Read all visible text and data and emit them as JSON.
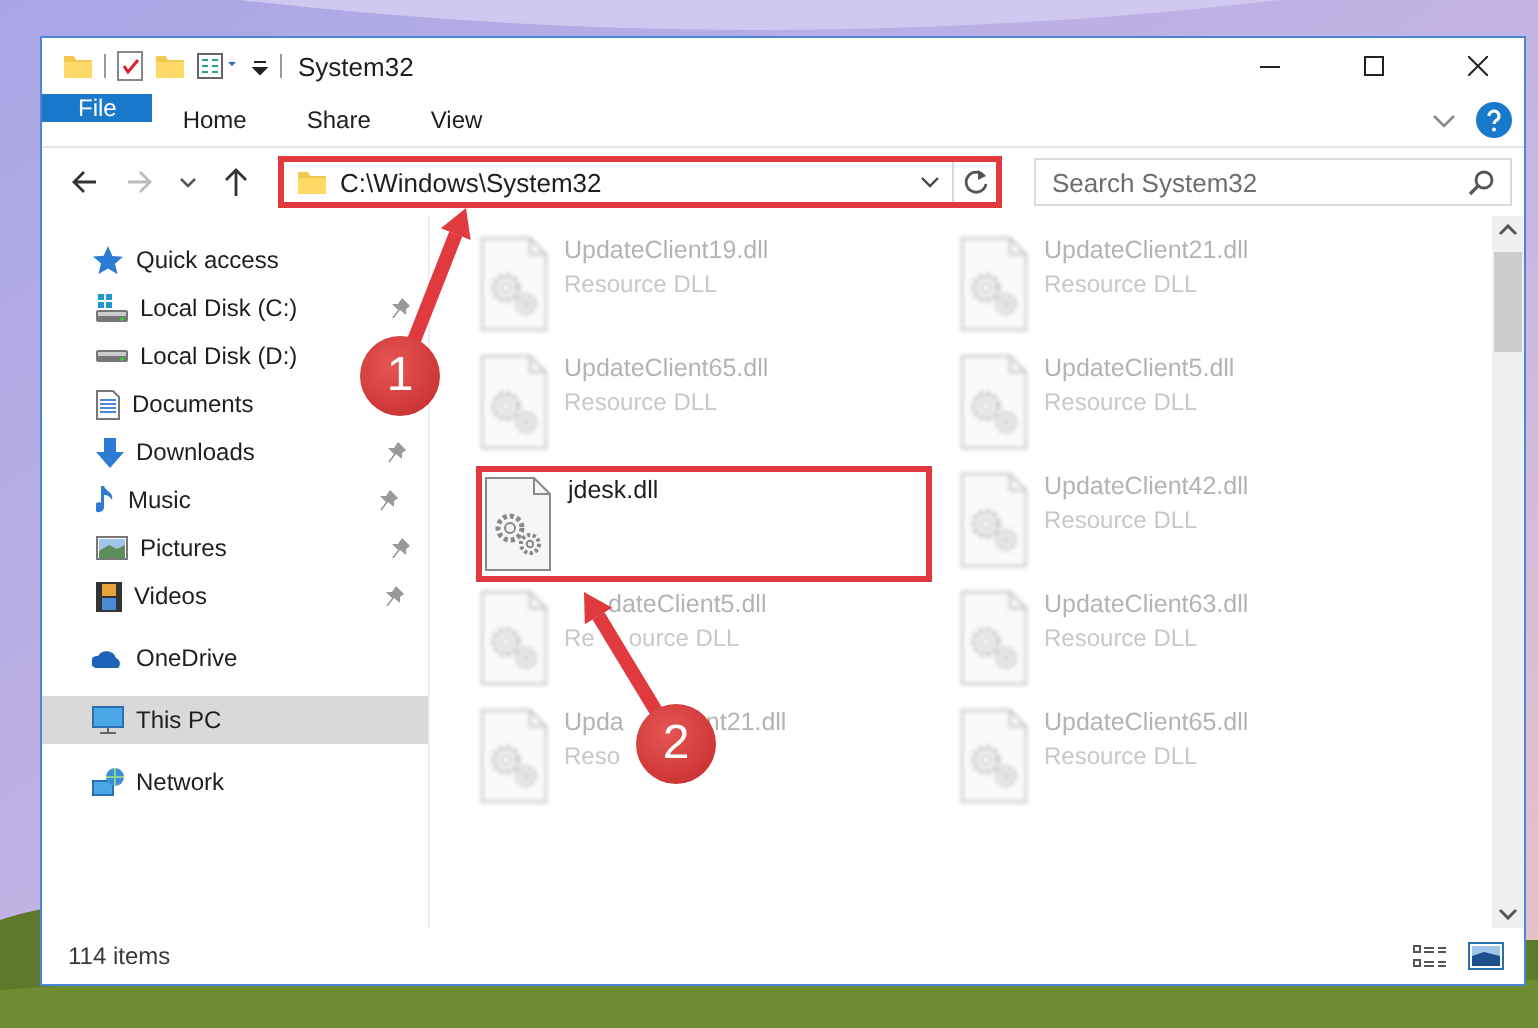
{
  "window": {
    "title": "System32"
  },
  "ribbon": {
    "tabs": [
      {
        "label": "File",
        "kind": "file"
      },
      {
        "label": "Home",
        "kind": "tab"
      },
      {
        "label": "Share",
        "kind": "tab"
      },
      {
        "label": "View",
        "kind": "tab"
      }
    ]
  },
  "address_bar": {
    "path": "C:\\Windows\\System32"
  },
  "search": {
    "placeholder": "Search System32"
  },
  "sidebar": {
    "items": [
      {
        "label": "Quick access",
        "selected": false,
        "children": [
          {
            "label": "Local Disk (C:)",
            "pinned": true
          },
          {
            "label": "Local Disk (D:)",
            "pinned": false
          },
          {
            "label": "Documents",
            "pinned": false
          },
          {
            "label": "Downloads",
            "pinned": true
          },
          {
            "label": "Music",
            "pinned": true
          },
          {
            "label": "Pictures",
            "pinned": true
          },
          {
            "label": "Videos",
            "pinned": true
          }
        ]
      },
      {
        "label": "OneDrive",
        "selected": false
      },
      {
        "label": "This PC",
        "selected": true
      },
      {
        "label": "Network",
        "selected": false
      }
    ]
  },
  "files": [
    {
      "name": [
        "UpdateClient19.dll"
      ],
      "type": [
        "Resource DLL"
      ],
      "highlighted": false
    },
    {
      "name": [
        "UpdateClient21.dll"
      ],
      "type": [
        "Resource DLL"
      ],
      "highlighted": false
    },
    {
      "name": [
        "UpdateClient65.dll"
      ],
      "type": [
        "Resource DLL"
      ],
      "highlighted": false
    },
    {
      "name": [
        "UpdateClient5.dll"
      ],
      "type": [
        "Resource DLL"
      ],
      "highlighted": false
    },
    {
      "name": [
        "jdesk.dll"
      ],
      "highlighted": true
    },
    {
      "name": [
        "UpdateClient42.dll"
      ],
      "type": [
        "Resource DLL"
      ],
      "highlighted": false
    },
    {
      "name": [
        "dateClient5.dll"
      ],
      "type": [
        "Re",
        "ource DLL"
      ],
      "highlighted": false
    },
    {
      "name": [
        "UpdateClient63.dll"
      ],
      "type": [
        "Resource DLL"
      ],
      "highlighted": false
    },
    {
      "name": [
        "Upda",
        "nt21.dll"
      ],
      "type": [
        "Reso"
      ],
      "highlighted": false
    },
    {
      "name": [
        "UpdateClient65.dll"
      ],
      "type": [
        "Resource DLL"
      ],
      "highlighted": false
    }
  ],
  "annotations": [
    {
      "number": "1"
    },
    {
      "number": "2"
    }
  ],
  "status_bar": {
    "item_count": "114 items"
  }
}
